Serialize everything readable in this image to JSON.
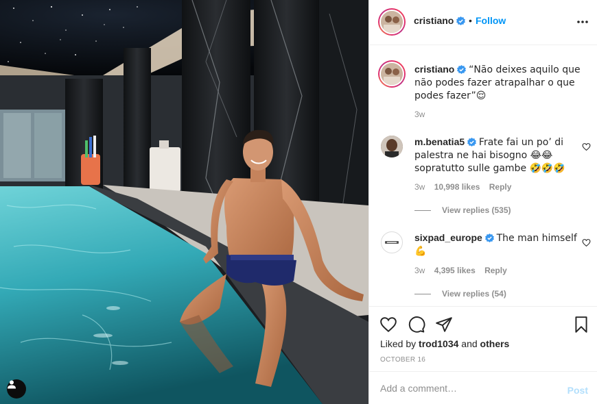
{
  "post": {
    "username": "cristiano",
    "separator": "•",
    "follow_label": "Follow",
    "caption": "“Não deixes aquilo que não podes fazer atrapalhar o que podes fazer”😌",
    "caption_time": "3w"
  },
  "comments": [
    {
      "username": "m.benatia5",
      "text": "Frate fai un po’ di palestra ne hai bisogno 😂😂 sopratutto sulle gambe 🤣🤣🤣",
      "time": "3w",
      "likes": "10,998 likes",
      "reply_label": "Reply",
      "view_replies": "View replies (535)"
    },
    {
      "username": "sixpad_europe",
      "text": "The man himself 💪",
      "time": "3w",
      "likes": "4,395 likes",
      "reply_label": "Reply",
      "view_replies": "View replies (54)"
    }
  ],
  "liked_by": {
    "prefix": "Liked by",
    "user": "trod1034",
    "conjunction": "and",
    "others": "others"
  },
  "date": "OCTOBER 16",
  "comment_input": {
    "placeholder": "Add a comment…"
  },
  "post_button": "Post",
  "icons": {
    "verified": "verified-badge-icon",
    "more": "more-options-icon",
    "like": "heart-icon",
    "comment": "comment-icon",
    "share": "share-icon",
    "save": "bookmark-icon",
    "tag": "user-tag-icon"
  },
  "colors": {
    "link_blue": "#0095f6",
    "post_disabled": "#b2dffc",
    "muted": "#8e8e8e",
    "pool": "#3fb7c4"
  }
}
